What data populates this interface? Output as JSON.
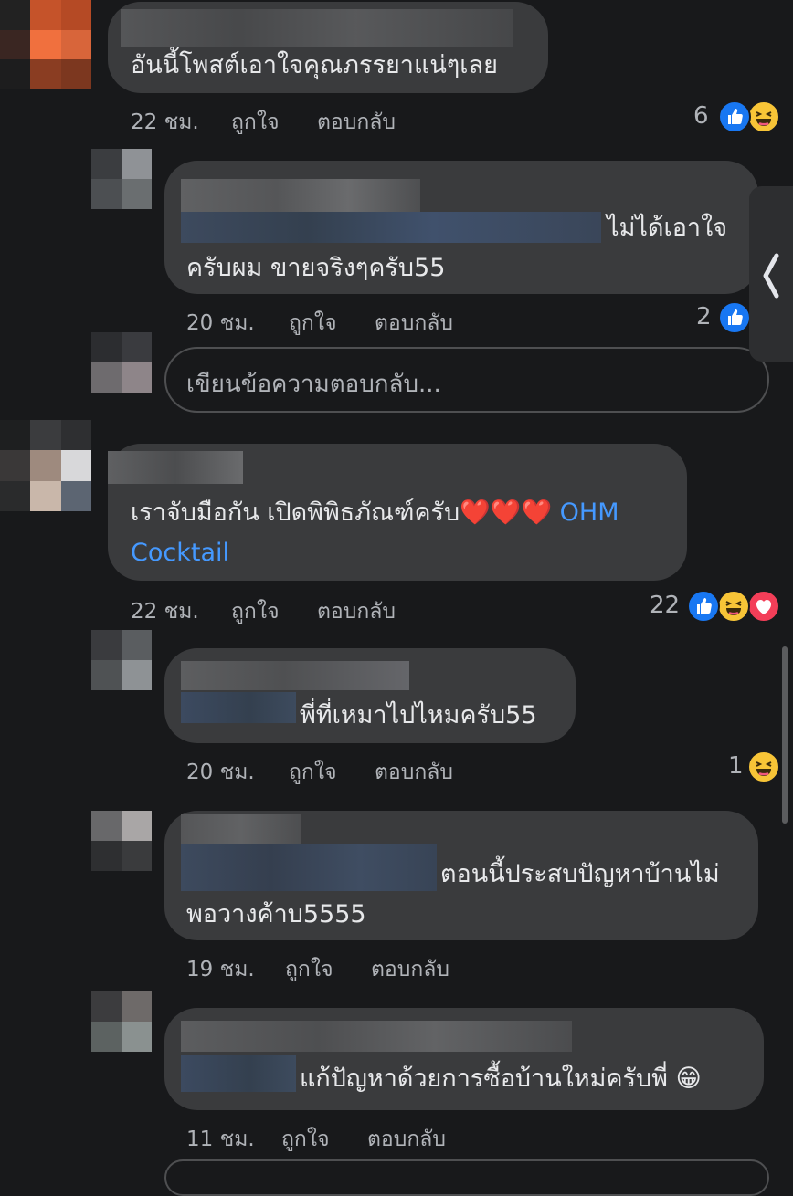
{
  "comments": [
    {
      "text_lines": [
        "อันนี้โพสต์เอาใจคุณภรรยาแน่ๆเลย"
      ],
      "time": "22 ชม.",
      "like": "ถูกใจ",
      "reply": "ตอบกลับ",
      "reaction_count": "6",
      "reactions": [
        "like",
        "haha"
      ]
    },
    {
      "text_lines": [
        "ไม่ได้เอาใจ",
        "ครับผม ขายจริงๆครับ55"
      ],
      "time": "20 ชม.",
      "like": "ถูกใจ",
      "reply": "ตอบกลับ",
      "reaction_count": "2",
      "reactions": [
        "like"
      ]
    },
    {
      "text_lines": [
        "เราจับมือกัน เปิดพิพิธภัณฑ์ครับ",
        "Cocktail"
      ],
      "hearts": "❤️❤️❤️",
      "mention_first": "OHM",
      "time": "22 ชม.",
      "like": "ถูกใจ",
      "reply": "ตอบกลับ",
      "reaction_count": "22",
      "reactions": [
        "like",
        "haha",
        "love"
      ]
    },
    {
      "text_lines": [
        "พี่ที่เหมาไปไหมครับ55"
      ],
      "time": "20 ชม.",
      "like": "ถูกใจ",
      "reply": "ตอบกลับ",
      "reaction_count": "1",
      "reactions": [
        "haha"
      ]
    },
    {
      "text_lines": [
        "ตอนนี้ประสบปัญหาบ้านไม่",
        "พอวางค้าบ5555"
      ],
      "time": "19 ชม.",
      "like": "ถูกใจ",
      "reply": "ตอบกลับ"
    },
    {
      "text_lines": [
        "แก้ปัญหาด้วยการซื้อบ้านใหม่ครับพี่"
      ],
      "emoji": "😁",
      "time": "11 ชม.",
      "like": "ถูกใจ",
      "reply": "ตอบกลับ"
    }
  ],
  "reply_box": {
    "placeholder": "เขียนข้อความตอบกลับ..."
  },
  "side_tab": {
    "icon": "chevron-left-icon"
  },
  "colors": {
    "background": "#18191b",
    "bubble": "#3a3b3d",
    "link": "#4599ff",
    "like": "#1877f2",
    "haha": "#f7c437",
    "love": "#f33e58"
  }
}
